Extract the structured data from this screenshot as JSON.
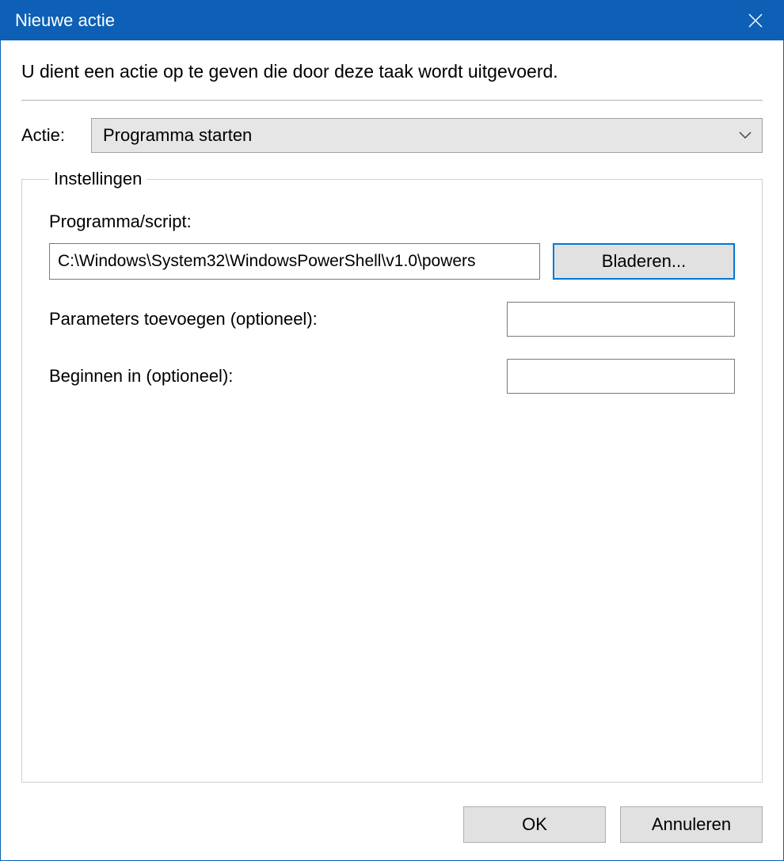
{
  "title": "Nieuwe actie",
  "instruction": "U dient een actie op te geven die door deze taak wordt uitgevoerd.",
  "action": {
    "label": "Actie:",
    "selected": "Programma starten"
  },
  "settings": {
    "legend": "Instellingen",
    "program": {
      "label": "Programma/script:",
      "value": "C:\\Windows\\System32\\WindowsPowerShell\\v1.0\\powers",
      "browse_label": "Bladeren..."
    },
    "params": {
      "label": "Parameters toevoegen (optioneel):",
      "value": ""
    },
    "startin": {
      "label": "Beginnen in (optioneel):",
      "value": ""
    }
  },
  "footer": {
    "ok_label": "OK",
    "cancel_label": "Annuleren"
  }
}
